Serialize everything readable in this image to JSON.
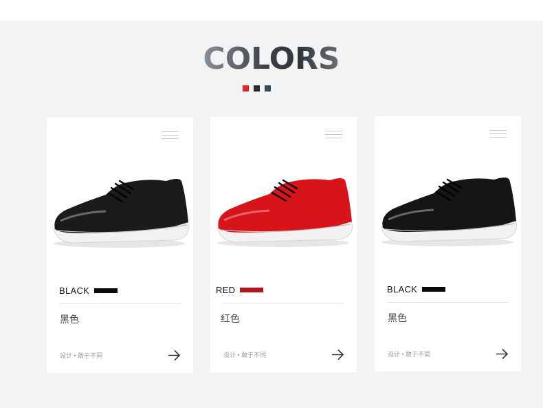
{
  "header": {
    "title": "COLORS",
    "swatches": [
      "#e0262a",
      "#2c2c2c",
      "#3a4d5f"
    ]
  },
  "cards": [
    {
      "color_en": "BLACK",
      "bar_color": "#0a0a0a",
      "color_cn": "黑色",
      "tagline": "设计 • 敢于不同",
      "shoe_color": "#1b1b1d",
      "arrow_icon": "arrow-right-icon",
      "menu_icon": "menu-lines-icon"
    },
    {
      "color_en": "RED",
      "bar_color": "#b0181d",
      "color_cn": "红色",
      "tagline": "设计 • 敢于不同",
      "shoe_color": "#d8141b",
      "arrow_icon": "arrow-right-icon",
      "menu_icon": "menu-lines-icon"
    },
    {
      "color_en": "BLACK",
      "bar_color": "#0a0a0a",
      "color_cn": "黑色",
      "tagline": "设计 • 敢于不同",
      "shoe_color": "#151517",
      "arrow_icon": "arrow-right-icon",
      "menu_icon": "menu-lines-icon"
    }
  ]
}
